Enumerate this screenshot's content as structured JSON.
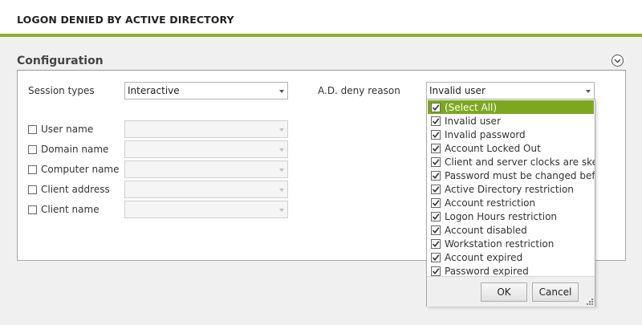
{
  "header": {
    "title": "LOGON DENIED BY ACTIVE DIRECTORY"
  },
  "section": {
    "title": "Configuration",
    "collapse_icon": "chevron-down-circle-icon"
  },
  "session": {
    "label": "Session types",
    "value": "Interactive"
  },
  "deny": {
    "label": "A.D. deny reason",
    "value": "Invalid user"
  },
  "filters": [
    {
      "label": "User name",
      "checked": false
    },
    {
      "label": "Domain name",
      "checked": false
    },
    {
      "label": "Computer name",
      "checked": false
    },
    {
      "label": "Client address",
      "checked": false
    },
    {
      "label": "Client name",
      "checked": false
    }
  ],
  "deny_options": [
    {
      "label": "(Select All)",
      "checked": true,
      "highlighted": true
    },
    {
      "label": "Invalid user",
      "checked": true
    },
    {
      "label": "Invalid password",
      "checked": true
    },
    {
      "label": "Account Locked Out",
      "checked": true
    },
    {
      "label": "Client and server clocks are skewed",
      "checked": true
    },
    {
      "label": "Password must be changed before",
      "checked": true
    },
    {
      "label": "Active Directory restriction",
      "checked": true
    },
    {
      "label": "Account restriction",
      "checked": true
    },
    {
      "label": "Logon Hours restriction",
      "checked": true
    },
    {
      "label": "Account disabled",
      "checked": true
    },
    {
      "label": "Workstation restriction",
      "checked": true
    },
    {
      "label": "Account expired",
      "checked": true
    },
    {
      "label": "Password expired",
      "checked": true
    }
  ],
  "popup_buttons": {
    "ok": "OK",
    "cancel": "Cancel"
  },
  "colors": {
    "accent": "#8ab22a",
    "selection": "#7ba81e"
  }
}
